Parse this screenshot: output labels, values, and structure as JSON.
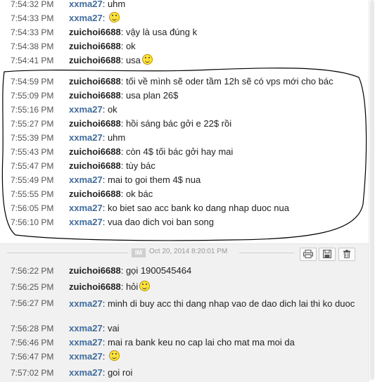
{
  "top_messages": [
    {
      "time": "7:54:32 PM",
      "sender": "xxma27",
      "text": "uhm",
      "emote": false
    },
    {
      "time": "7:54:33 PM",
      "sender": "xxma27",
      "text": "",
      "emote": true
    },
    {
      "time": "7:54:33 PM",
      "sender": "zuichoi6688",
      "text": "vậy là usa đúng k",
      "emote": false
    },
    {
      "time": "7:54:38 PM",
      "sender": "zuichoi6688",
      "text": "ok",
      "emote": false
    },
    {
      "time": "7:54:41 PM",
      "sender": "zuichoi6688",
      "text": "usa",
      "emote": true
    },
    {
      "time": "7:54:59 PM",
      "sender": "zuichoi6688",
      "text": "tối về mình sẽ oder tầm 12h sẽ có vps mới cho bác",
      "emote": false
    },
    {
      "time": "7:55:09 PM",
      "sender": "zuichoi6688",
      "text": "usa plan 26$",
      "emote": false
    },
    {
      "time": "7:55:16 PM",
      "sender": "xxma27",
      "text": "ok",
      "emote": false
    },
    {
      "time": "7:55:27 PM",
      "sender": "zuichoi6688",
      "text": "hồi sáng bác gởi e 22$ rồi",
      "emote": false
    },
    {
      "time": "7:55:39 PM",
      "sender": "xxma27",
      "text": "uhm",
      "emote": false
    },
    {
      "time": "7:55:43 PM",
      "sender": "zuichoi6688",
      "text": "còn 4$ tối bác gởi hay mai",
      "emote": false
    },
    {
      "time": "7:55:47 PM",
      "sender": "zuichoi6688",
      "text": "tùy bác",
      "emote": false
    },
    {
      "time": "7:55:49 PM",
      "sender": "xxma27",
      "text": "mai to goi them 4$ nua",
      "emote": false
    },
    {
      "time": "7:55:55 PM",
      "sender": "zuichoi6688",
      "text": "ok bác",
      "emote": false
    },
    {
      "time": "7:56:05 PM",
      "sender": "xxma27",
      "text": "ko biet sao acc bank ko dang nhap duoc nua",
      "emote": false
    },
    {
      "time": "7:56:10 PM",
      "sender": "xxma27",
      "text": "vua dao dich voi ban song",
      "emote": false
    }
  ],
  "separator": {
    "badge": "IM",
    "date": "Oct 20, 2014 8:20:01 PM"
  },
  "toolbar": {
    "print_icon": "print-icon",
    "save_icon": "save-icon",
    "delete_icon": "trash-icon"
  },
  "bottom_messages": [
    {
      "time": "7:56:22 PM",
      "sender": "zuichoi6688",
      "text": "gọi 1900545464",
      "emote": false
    },
    {
      "time": "7:56:25 PM",
      "sender": "zuichoi6688",
      "text": "hỏi",
      "emote": true
    },
    {
      "time": "7:56:27 PM",
      "sender": "xxma27",
      "text": "minh di buy acc thi dang nhap vao de dao dich lai thi ko duoc",
      "emote": false
    },
    {
      "time": "7:56:28 PM",
      "sender": "xxma27",
      "text": "vai",
      "emote": false
    },
    {
      "time": "7:56:46 PM",
      "sender": "xxma27",
      "text": "mai ra bank keu no cap lai cho mat ma moi da",
      "emote": false
    },
    {
      "time": "7:56:47 PM",
      "sender": "xxma27",
      "text": "",
      "emote": true
    },
    {
      "time": "7:57:02 PM",
      "sender": "xxma27",
      "text": "goi roi",
      "emote": false
    }
  ],
  "colors": {
    "xxma27": "#426c9b",
    "zuichoi6688": "#222222",
    "annotation": "#000000"
  }
}
